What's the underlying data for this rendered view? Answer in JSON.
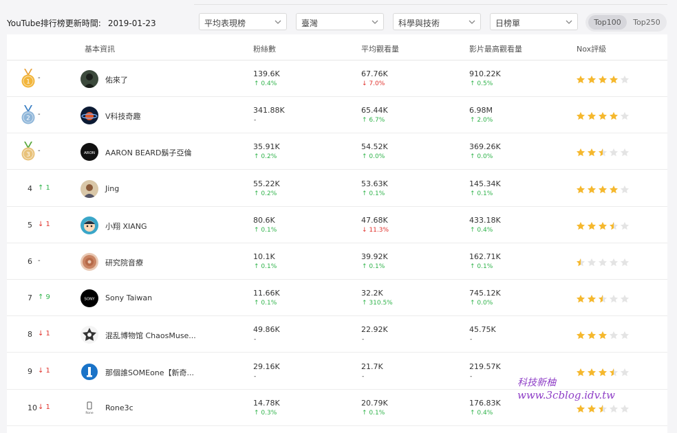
{
  "header": {
    "update_label": "YouTube排行榜更新時間:",
    "update_date": "2019-01-23",
    "filters": [
      "平均表現榜",
      "臺灣",
      "科學與技術",
      "日榜單"
    ],
    "toggle": [
      {
        "label": "Top100",
        "active": true
      },
      {
        "label": "Top250",
        "active": false
      }
    ]
  },
  "table": {
    "columns": [
      "基本資訊",
      "粉絲數",
      "平均觀看量",
      "影片最高觀看量",
      "Nox評級"
    ],
    "rows": [
      {
        "rank": "1",
        "change": "-",
        "change_dir": "none",
        "medal": "gold",
        "avatar": "dark-figure-avatar",
        "name": "佑來了",
        "fans": "139.6K",
        "fans_delta": "↑ 0.4%",
        "fans_dir": "up",
        "avg": "67.76K",
        "avg_delta": "↓ 7.0%",
        "avg_dir": "down",
        "max": "910.22K",
        "max_delta": "↑ 0.5%",
        "max_dir": "up",
        "stars": 4
      },
      {
        "rank": "2",
        "change": "-",
        "change_dir": "none",
        "medal": "silver",
        "avatar": "planet-avatar",
        "name": "V科技奇趣",
        "fans": "341.88K",
        "fans_delta": "-",
        "fans_dir": "none",
        "avg": "65.44K",
        "avg_delta": "↑ 6.7%",
        "avg_dir": "up",
        "max": "6.98M",
        "max_delta": "↑ 2.0%",
        "max_dir": "up",
        "stars": 4
      },
      {
        "rank": "3",
        "change": "-",
        "change_dir": "none",
        "medal": "bronze",
        "avatar": "aaron-logo-avatar",
        "name": "AARON BEARD鬍子亞倫",
        "fans": "35.91K",
        "fans_delta": "↑ 0.2%",
        "fans_dir": "up",
        "avg": "54.52K",
        "avg_delta": "↑ 0.0%",
        "avg_dir": "up",
        "max": "369.26K",
        "max_delta": "↑ 0.0%",
        "max_dir": "up",
        "stars": 2.5
      },
      {
        "rank": "4",
        "change": "↑ 1",
        "change_dir": "up",
        "medal": "",
        "avatar": "person-avatar",
        "name": "Jing",
        "fans": "55.22K",
        "fans_delta": "↑ 0.2%",
        "fans_dir": "up",
        "avg": "53.63K",
        "avg_delta": "↑ 0.1%",
        "avg_dir": "up",
        "max": "145.34K",
        "max_delta": "↑ 0.1%",
        "max_dir": "up",
        "stars": 4
      },
      {
        "rank": "5",
        "change": "↓ 1",
        "change_dir": "down",
        "medal": "",
        "avatar": "cartoon-avatar",
        "name": "小翔 XIANG",
        "fans": "80.6K",
        "fans_delta": "↑ 0.1%",
        "fans_dir": "up",
        "avg": "47.68K",
        "avg_delta": "↓ 11.3%",
        "avg_dir": "down",
        "max": "433.18K",
        "max_delta": "↑ 0.4%",
        "max_dir": "up",
        "stars": 3.5
      },
      {
        "rank": "6",
        "change": "-",
        "change_dir": "none",
        "medal": "",
        "avatar": "disc-avatar",
        "name": "研究院音療",
        "fans": "10.1K",
        "fans_delta": "↑ 0.1%",
        "fans_dir": "up",
        "avg": "39.92K",
        "avg_delta": "↑ 0.1%",
        "avg_dir": "up",
        "max": "162.71K",
        "max_delta": "↑ 0.1%",
        "max_dir": "up",
        "stars": 0.5
      },
      {
        "rank": "7",
        "change": "↑ 9",
        "change_dir": "up",
        "medal": "",
        "avatar": "sony-logo-avatar",
        "name": "Sony Taiwan",
        "fans": "11.66K",
        "fans_delta": "↑ 0.1%",
        "fans_dir": "up",
        "avg": "32.2K",
        "avg_delta": "↑ 310.5%",
        "avg_dir": "up",
        "max": "745.12K",
        "max_delta": "↑ 0.0%",
        "max_dir": "up",
        "stars": 2.5
      },
      {
        "rank": "8",
        "change": "↓ 1",
        "change_dir": "down",
        "medal": "",
        "avatar": "chaos-logo-avatar",
        "name": "混乱博物馆 ChaosMuse...",
        "fans": "49.86K",
        "fans_delta": "-",
        "fans_dir": "none",
        "avg": "22.92K",
        "avg_delta": "-",
        "avg_dir": "none",
        "max": "45.75K",
        "max_delta": "-",
        "max_dir": "none",
        "stars": 3
      },
      {
        "rank": "9",
        "change": "↓ 1",
        "change_dir": "down",
        "medal": "",
        "avatar": "someone-logo-avatar",
        "name": "那個誰SOMEone【新奇...",
        "fans": "29.16K",
        "fans_delta": "-",
        "fans_dir": "none",
        "avg": "21.7K",
        "avg_delta": "-",
        "avg_dir": "none",
        "max": "219.57K",
        "max_delta": "-",
        "max_dir": "none",
        "stars": 3.5
      },
      {
        "rank": "10",
        "change": "↓ 1",
        "change_dir": "down",
        "medal": "",
        "avatar": "rone-logo-avatar",
        "name": "Rone3c",
        "fans": "14.78K",
        "fans_delta": "↑ 0.3%",
        "fans_dir": "up",
        "avg": "20.79K",
        "avg_delta": "↑ 0.1%",
        "avg_dir": "up",
        "max": "176.83K",
        "max_delta": "↑ 0.4%",
        "max_dir": "up",
        "stars": 2.5
      }
    ]
  },
  "watermark": {
    "line1": "科技新柚",
    "line2": "www.3cblog.idv.tw"
  },
  "colors": {
    "up": "#2fb34a",
    "down": "#e0312b",
    "star": "#f5b82e",
    "star_empty": "#e4e4e4",
    "gold": "#f2b53a",
    "silver": "#8fb6d9",
    "bronze": "#e8c27a"
  }
}
